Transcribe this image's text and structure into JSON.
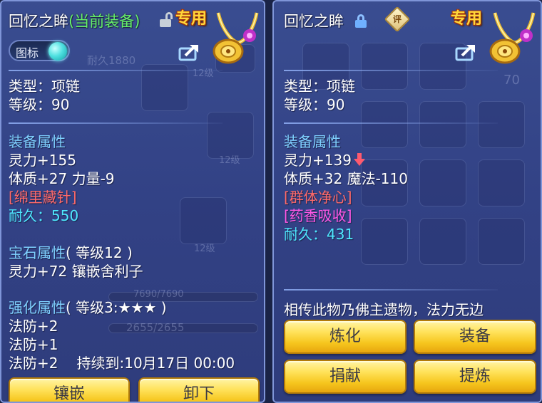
{
  "left": {
    "title": "回忆之眸",
    "equipped_tag": "(当前装备)",
    "exclusive": "专用",
    "toggle_label": "图标",
    "type_line": "类型：项链",
    "level_line": "等级：90",
    "equip_attr_heading": "装备属性",
    "attr_lines": [
      "灵力+155",
      "体质+27 力量-9"
    ],
    "special_skill": "[绵里藏针]",
    "durability_label": "耐久：",
    "durability_value": "550",
    "gem_heading": "宝石属性",
    "gem_level": "( 等级12 )",
    "gem_line": "灵力+72 镶嵌舍利子",
    "enhance_heading": "强化属性",
    "enhance_level": "( 等级3:★★★ )",
    "enhance_lines": [
      "法防+2",
      "法防+1"
    ],
    "enhance_timed": "法防+2",
    "enhance_timed_until": "持续到:10月17日 00:00",
    "buttons": [
      "镶嵌",
      "卸下"
    ],
    "bg_texts": {
      "durability": "耐久1880",
      "lv_a": "12级",
      "lv_b": "12级",
      "lv_c": "12级",
      "bar_a": "7690/7690",
      "bar_b": "2655/2655"
    }
  },
  "right": {
    "title": "回忆之眸",
    "rate_badge": "评",
    "exclusive": "专用",
    "type_line": "类型：项链",
    "level_line": "等级：90",
    "equip_attr_heading": "装备属性",
    "attr_line_1": "灵力+139",
    "attr_line_2": "体质+32 魔法-110",
    "special_effect": "[群体净心]",
    "special_skill": "[药香吸收]",
    "durability_label": "耐久：",
    "durability_value": "431",
    "description": "相传此物乃佛主遗物，法力无边",
    "buttons": [
      "炼化",
      "装备",
      "捐献",
      "提炼"
    ],
    "bg_texts": {
      "count": "70"
    }
  },
  "colors": {
    "panel_bg": "#3c5096",
    "section_heading": "#7fd0ff",
    "equipped_green": "#66f06a",
    "special_red": "#ff6a6a",
    "special_magenta": "#ff58e6",
    "durability_cyan": "#4fe8ff",
    "exclusive_gold": "#ffd83a",
    "button_gold": "#f6c61e"
  },
  "icons": [
    "open-lock-icon",
    "lock-icon",
    "share-icon",
    "necklace-icon",
    "down-arrow-icon",
    "rate-badge-icon"
  ]
}
